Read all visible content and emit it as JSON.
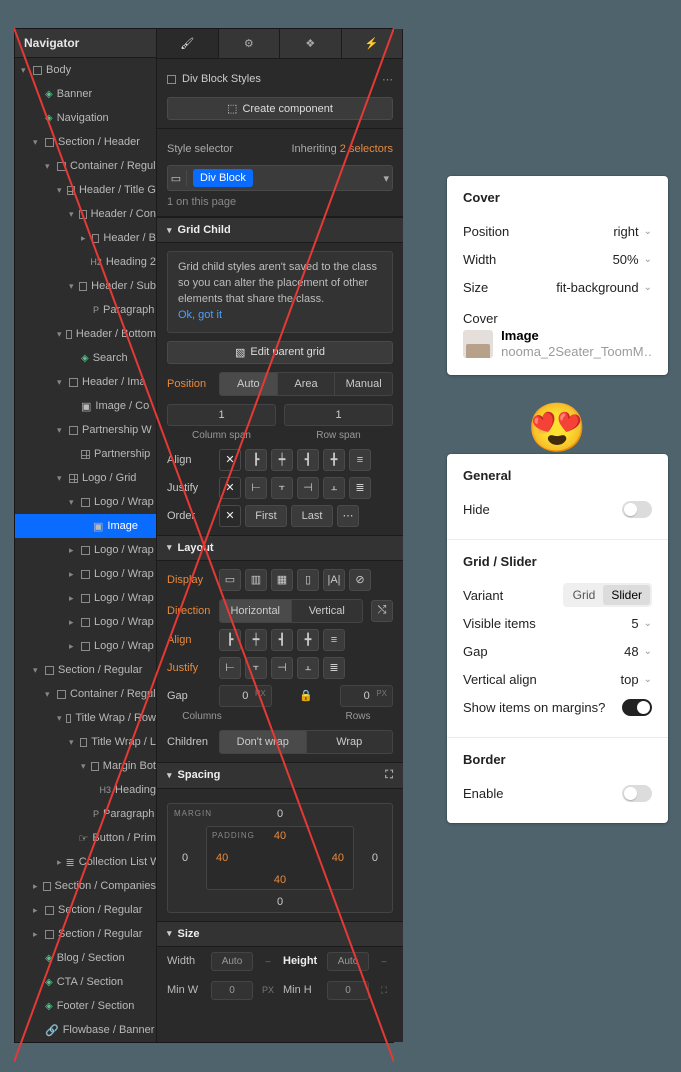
{
  "navigator": {
    "title": "Navigator",
    "tree": [
      {
        "d": 0,
        "t": "body",
        "exp": 1,
        "label": "Body"
      },
      {
        "d": 1,
        "t": "sec",
        "label": "Banner"
      },
      {
        "d": 1,
        "t": "sec",
        "label": "Navigation"
      },
      {
        "d": 1,
        "t": "box",
        "exp": 1,
        "label": "Section / Header"
      },
      {
        "d": 2,
        "t": "box",
        "exp": 1,
        "label": "Container / Regul"
      },
      {
        "d": 3,
        "t": "grid",
        "exp": 1,
        "label": "Header / Title G"
      },
      {
        "d": 4,
        "t": "box",
        "exp": 1,
        "label": "Header / Con"
      },
      {
        "d": 5,
        "t": "box",
        "closed": 1,
        "label": "Header / B"
      },
      {
        "d": 5,
        "t": "h",
        "h": "H2",
        "label": "Heading 2"
      },
      {
        "d": 4,
        "t": "box",
        "exp": 1,
        "label": "Header / Sub"
      },
      {
        "d": 5,
        "t": "p",
        "label": "Paragraph"
      },
      {
        "d": 3,
        "t": "box",
        "exp": 1,
        "label": "Header / Bottom"
      },
      {
        "d": 4,
        "t": "sec",
        "label": "Search"
      },
      {
        "d": 3,
        "t": "box",
        "exp": 1,
        "label": "Header / Ima"
      },
      {
        "d": 4,
        "t": "img",
        "label": "Image / Co"
      },
      {
        "d": 3,
        "t": "box",
        "exp": 1,
        "label": "Partnership W"
      },
      {
        "d": 4,
        "t": "grid",
        "label": "Partnership"
      },
      {
        "d": 3,
        "t": "grid",
        "exp": 1,
        "label": "Logo / Grid"
      },
      {
        "d": 4,
        "t": "box",
        "exp": 1,
        "label": "Logo / Wrap"
      },
      {
        "d": 5,
        "t": "img",
        "sel": 1,
        "label": "Image"
      },
      {
        "d": 4,
        "t": "box",
        "closed": 1,
        "label": "Logo / Wrap"
      },
      {
        "d": 4,
        "t": "box",
        "closed": 1,
        "label": "Logo / Wrap"
      },
      {
        "d": 4,
        "t": "box",
        "closed": 1,
        "label": "Logo / Wrap"
      },
      {
        "d": 4,
        "t": "box",
        "closed": 1,
        "label": "Logo / Wrap"
      },
      {
        "d": 4,
        "t": "box",
        "closed": 1,
        "label": "Logo / Wrap"
      },
      {
        "d": 1,
        "t": "box",
        "exp": 1,
        "label": "Section / Regular"
      },
      {
        "d": 2,
        "t": "box",
        "exp": 1,
        "label": "Container / Regul"
      },
      {
        "d": 3,
        "t": "box",
        "exp": 1,
        "label": "Title Wrap / Row"
      },
      {
        "d": 4,
        "t": "box",
        "exp": 1,
        "label": "Title Wrap / L"
      },
      {
        "d": 5,
        "t": "box",
        "exp": 1,
        "label": "Margin Bot"
      },
      {
        "d": 6,
        "t": "h",
        "h": "H3",
        "label": "Heading"
      },
      {
        "d": 5,
        "t": "p",
        "label": "Paragraph"
      },
      {
        "d": 4,
        "t": "btn",
        "label": "Button / Prim"
      },
      {
        "d": 3,
        "t": "coll",
        "closed": 1,
        "label": "Collection List W"
      },
      {
        "d": 1,
        "t": "box",
        "closed": 1,
        "label": "Section / Companies"
      },
      {
        "d": 1,
        "t": "box",
        "closed": 1,
        "label": "Section / Regular"
      },
      {
        "d": 1,
        "t": "box",
        "closed": 1,
        "label": "Section / Regular"
      },
      {
        "d": 1,
        "t": "sec",
        "label": "Blog / Section"
      },
      {
        "d": 1,
        "t": "sec",
        "label": "CTA / Section"
      },
      {
        "d": 1,
        "t": "sec",
        "label": "Footer / Section"
      },
      {
        "d": 1,
        "t": "link",
        "label": "Flowbase / Banner"
      }
    ]
  },
  "styles": {
    "divBlockStyles": "Div Block Styles",
    "createComponent": "Create component",
    "selectorLabel": "Style selector",
    "inheritingPrefix": "Inheriting",
    "inheritingCount": "2 selectors",
    "chip": "Div Block",
    "onPage": "1 on this page",
    "gridChild": {
      "title": "Grid Child",
      "info": "Grid child styles aren't saved to the class so you can alter the placement of other elements that share the class.",
      "ok": "Ok, got it",
      "editParent": "Edit parent grid",
      "positionLabel": "Position",
      "positionOpts": [
        "Auto",
        "Area",
        "Manual"
      ],
      "colSpan": "1",
      "rowSpan": "1",
      "colSpanLabel": "Column span",
      "rowSpanLabel": "Row span",
      "alignLabel": "Align",
      "justifyLabel": "Justify",
      "orderLabel": "Order",
      "orderOpts": [
        "First",
        "Last"
      ]
    },
    "layout": {
      "title": "Layout",
      "display": "Display",
      "direction": "Direction",
      "dirOpts": [
        "Horizontal",
        "Vertical"
      ],
      "align": "Align",
      "justify": "Justify",
      "gap": "Gap",
      "gapCol": "0",
      "gapRow": "0",
      "gapUnit": "PX",
      "colLabel": "Columns",
      "rowLabel": "Rows",
      "children": "Children",
      "wrapOpts": [
        "Don't wrap",
        "Wrap"
      ]
    },
    "spacing": {
      "title": "Spacing",
      "marginLabel": "MARGIN",
      "paddingLabel": "PADDING",
      "mTop": "0",
      "mRight": "0",
      "mBottom": "0",
      "mLeft": "0",
      "pTop": "40",
      "pRight": "40",
      "pBottom": "40",
      "pLeft": "40"
    },
    "size": {
      "title": "Size",
      "widthL": "Width",
      "widthV": "Auto",
      "heightL": "Height",
      "heightV": "Auto",
      "minWL": "Min W",
      "minWV": "0",
      "minWU": "PX",
      "minHL": "Min H",
      "minHV": "0"
    }
  },
  "coverCard": {
    "title": "Cover",
    "position": {
      "label": "Position",
      "value": "right"
    },
    "width": {
      "label": "Width",
      "value": "50%"
    },
    "size": {
      "label": "Size",
      "value": "fit-background"
    },
    "coverLabel": "Cover",
    "asset": {
      "name": "Image",
      "file": "nooma_2Seater_ToomMod..."
    }
  },
  "sliderCard": {
    "general": {
      "title": "General",
      "hide": "Hide",
      "hideOn": false
    },
    "grid": {
      "title": "Grid / Slider",
      "variant": {
        "label": "Variant",
        "opts": [
          "Grid",
          "Slider"
        ],
        "value": "Slider"
      },
      "visible": {
        "label": "Visible items",
        "value": "5"
      },
      "gap": {
        "label": "Gap",
        "value": "48"
      },
      "valign": {
        "label": "Vertical align",
        "value": "top"
      },
      "showMargins": {
        "label": "Show items on margins?",
        "on": true
      }
    },
    "border": {
      "title": "Border",
      "enable": "Enable",
      "on": false
    }
  }
}
